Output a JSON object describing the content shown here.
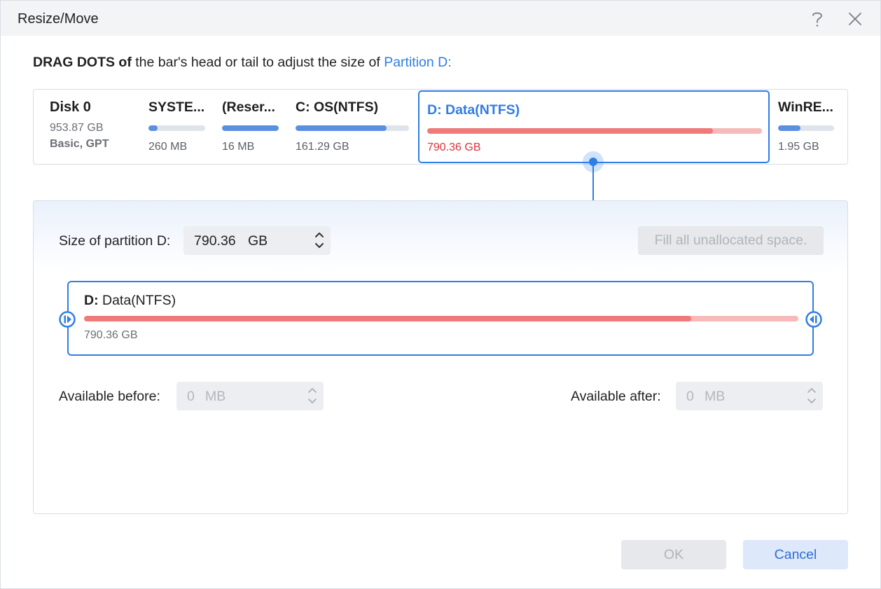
{
  "window": {
    "title": "Resize/Move"
  },
  "instruction": {
    "strong": "DRAG DOTS of",
    "text": " the bar's head or tail to adjust the size of ",
    "accent": "Partition D:"
  },
  "disk": {
    "name": "Disk 0",
    "size": "953.87 GB",
    "type": "Basic, GPT",
    "partitions": [
      {
        "name": "SYSTE...",
        "size": "260 MB",
        "used_fraction": 0.16
      },
      {
        "name": "(Reser...",
        "size": "16 MB",
        "used_fraction": 1.0
      },
      {
        "name": "C: OS(NTFS)",
        "size": "161.29 GB",
        "used_fraction": 0.8
      },
      {
        "name": "D: Data(NTFS)",
        "size": "790.36 GB",
        "used_fraction": 0.853,
        "selected": true
      },
      {
        "name": "WinRE...",
        "size": "1.95 GB",
        "used_fraction": 0.4
      }
    ]
  },
  "editor": {
    "size_label": "Size of partition D:",
    "size_value": "790.36",
    "size_unit": "GB",
    "fill_button": "Fill all unallocated space.",
    "partition_prefix": "D:",
    "partition_name": "Data(NTFS)",
    "partition_size": "790.36 GB",
    "used_fraction": 0.85,
    "available_before_label": "Available before:",
    "available_before_value": "0",
    "available_before_unit": "MB",
    "available_after_label": "Available after:",
    "available_after_value": "0",
    "available_after_unit": "MB"
  },
  "buttons": {
    "ok": "OK",
    "cancel": "Cancel"
  },
  "colors": {
    "accent": "#2f7ee6",
    "partition_used": "#f07a7a",
    "partition_free": "#f7b9b9",
    "other_partition_used": "#5b8fe0",
    "size_red": "#e0323a"
  }
}
